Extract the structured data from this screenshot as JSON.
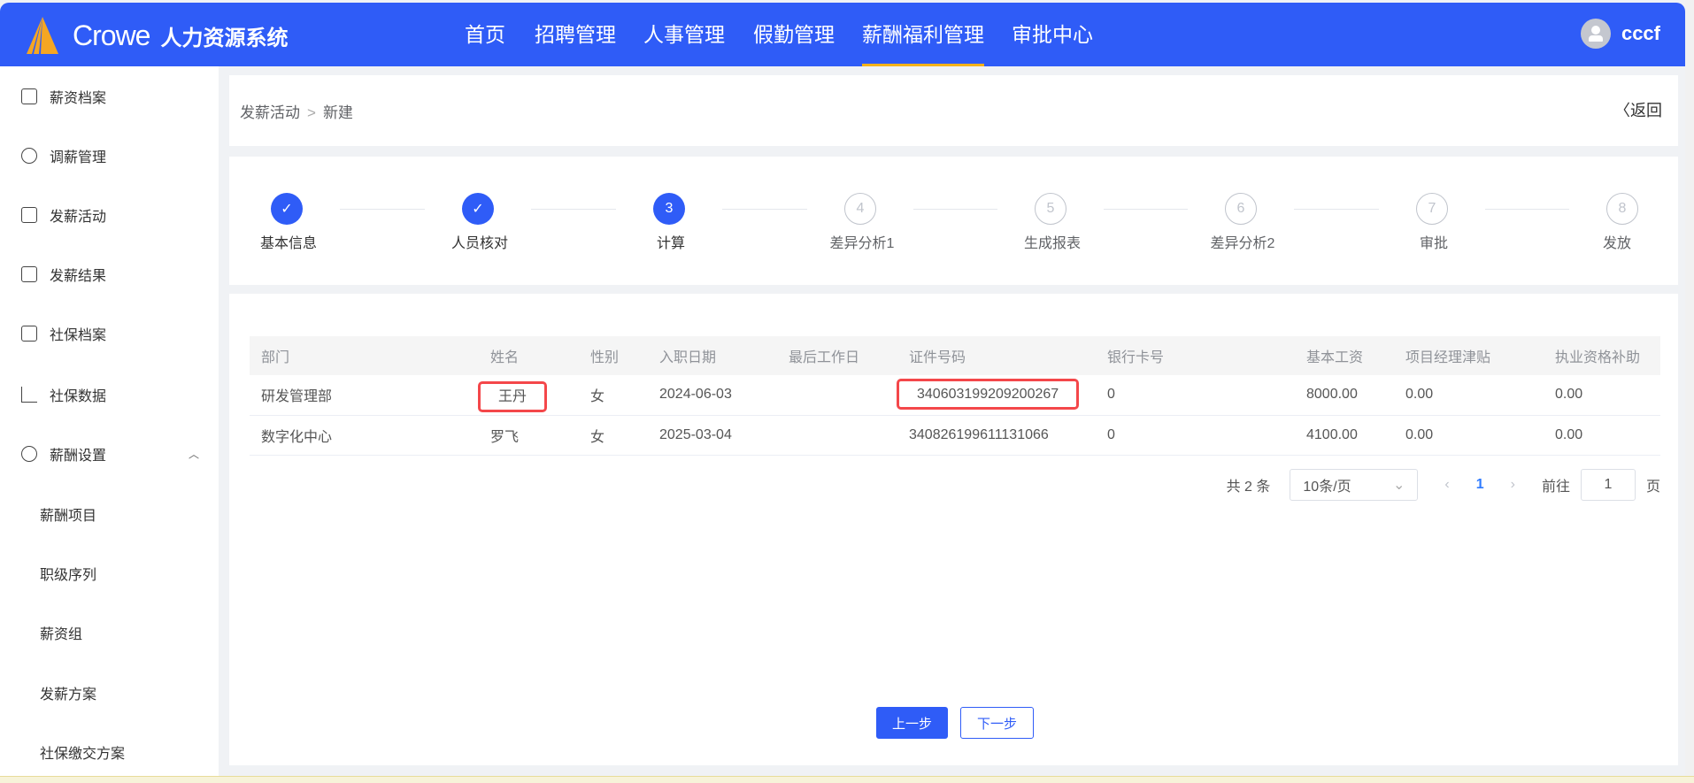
{
  "header": {
    "brand": "Crowe",
    "system": "人力资源系统",
    "nav": [
      "首页",
      "招聘管理",
      "人事管理",
      "假勤管理",
      "薪酬福利管理",
      "审批中心"
    ],
    "active_nav": "薪酬福利管理",
    "user": "cccf",
    "accent": "#2f5cf7"
  },
  "sidebar": {
    "items": [
      "薪资档案",
      "调薪管理",
      "发薪活动",
      "发薪结果",
      "社保档案",
      "社保数据",
      "薪酬设置"
    ],
    "sub_items": [
      "薪酬项目",
      "职级序列",
      "薪资组",
      "发薪方案",
      "社保缴交方案"
    ]
  },
  "breadcrumb": {
    "parent": "发薪活动",
    "current": "新建",
    "back": "返回"
  },
  "steps": [
    {
      "n": "1",
      "label": "基本信息",
      "state": "done"
    },
    {
      "n": "2",
      "label": "人员核对",
      "state": "done"
    },
    {
      "n": "3",
      "label": "计算",
      "state": "current"
    },
    {
      "n": "4",
      "label": "差异分析1",
      "state": "todo"
    },
    {
      "n": "5",
      "label": "生成报表",
      "state": "todo"
    },
    {
      "n": "6",
      "label": "差异分析2",
      "state": "todo"
    },
    {
      "n": "7",
      "label": "审批",
      "state": "todo"
    },
    {
      "n": "8",
      "label": "发放",
      "state": "todo"
    }
  ],
  "table": {
    "columns": [
      "部门",
      "姓名",
      "性别",
      "入职日期",
      "最后工作日",
      "证件号码",
      "银行卡号",
      "基本工资",
      "项目经理津贴",
      "执业资格补助"
    ],
    "rows": [
      [
        "研发管理部",
        "王丹",
        "女",
        "2024-06-03",
        "",
        "340603199209200267",
        "0",
        "8000.00",
        "0.00",
        "0.00"
      ],
      [
        "数字化中心",
        "罗飞",
        "女",
        "2025-03-04",
        "",
        "340826199611131066",
        "0",
        "4100.00",
        "0.00",
        "0.00"
      ]
    ]
  },
  "pagination": {
    "total": "共 2 条",
    "page_size": "10条/页",
    "current": "1",
    "goto_label": "前往",
    "goto_value": "1",
    "page_suffix": "页"
  },
  "actions": {
    "prev": "上一步",
    "next": "下一步"
  }
}
